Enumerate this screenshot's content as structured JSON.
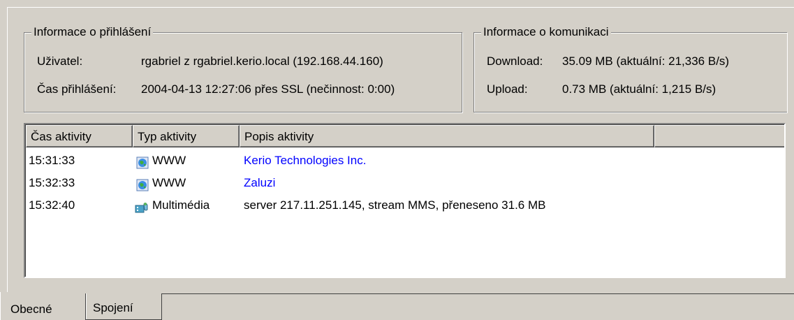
{
  "login_info": {
    "legend": "Informace o přihlášení",
    "user_label": "Uživatel:",
    "user_value": "rgabriel z rgabriel.kerio.local (192.168.44.160)",
    "time_label": "Čas přihlášení:",
    "time_value": "2004-04-13 12:27:06 přes SSL (nečinnost: 0:00)"
  },
  "comm_info": {
    "legend": "Informace o komunikaci",
    "download_label": "Download:",
    "download_value": "35.09 MB (aktuální: 21,336 B/s)",
    "upload_label": "Upload:",
    "upload_value": "0.73 MB (aktuální: 1,215 B/s)"
  },
  "activity_table": {
    "columns": [
      "Čas aktivity",
      "Typ aktivity",
      "Popis aktivity",
      ""
    ],
    "rows": [
      {
        "time": "15:31:33",
        "type": "WWW",
        "type_icon": "globe-icon",
        "description": "Kerio Technologies Inc.",
        "is_link": true
      },
      {
        "time": "15:32:33",
        "type": "WWW",
        "type_icon": "globe-icon",
        "description": "Zaluzi",
        "is_link": true
      },
      {
        "time": "15:32:40",
        "type": "Multimédia",
        "type_icon": "multimedia-icon",
        "description": "server 217.11.251.145, stream MMS, přeneseno 31.6 MB",
        "is_link": false
      }
    ]
  },
  "tabs": {
    "general": "Obecné",
    "connections": "Spojení",
    "active": "Obecné"
  },
  "colors": {
    "background": "#d4d0c8",
    "link": "#0000ff"
  }
}
